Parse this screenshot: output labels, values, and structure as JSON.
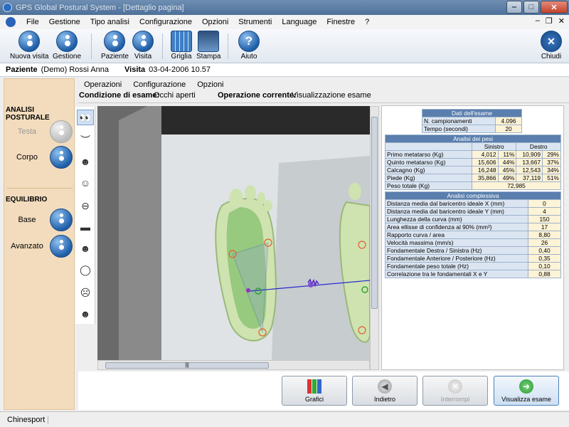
{
  "window": {
    "title": "GPS Global Postural System - [Dettaglio pagina]"
  },
  "menu": {
    "items": [
      "File",
      "Gestione",
      "Tipo analisi",
      "Configurazione",
      "Opzioni",
      "Strumenti",
      "Language",
      "Finestre",
      "?"
    ]
  },
  "toolbar": {
    "nuova_visita": "Nuova visita",
    "gestione": "Gestione",
    "paziente": "Paziente",
    "visita": "Visita",
    "griglia": "Griglia",
    "stampa": "Stampa",
    "aiuto": "Aiuto",
    "chiudi": "Chiudi"
  },
  "patient": {
    "label": "Paziente",
    "name": "(Demo) Rossi Anna",
    "visit_label": "Visita",
    "visit_date": "03-04-2006 10.57"
  },
  "left_panel": {
    "section1": "ANALISI POSTURALE",
    "testa": "Testa",
    "corpo": "Corpo",
    "section2": "EQUILIBRIO",
    "base": "Base",
    "avanzato": "Avanzato"
  },
  "subtabs": [
    "Operazioni",
    "Configurazione",
    "Opzioni"
  ],
  "condition": {
    "label": "Condizione di esame:",
    "value": "Occhi aperti",
    "op_label": "Operazione corrente:",
    "op_value": "Visualizzazione esame"
  },
  "exam_data": {
    "title": "Dati dell'esame",
    "rows": [
      {
        "label": "N. campionamenti",
        "value": "4.096"
      },
      {
        "label": "Tempo (secondi)",
        "value": "20"
      }
    ]
  },
  "weights": {
    "title": "Analisi dei pesi",
    "left": "Sinistro",
    "right": "Destro",
    "rows": [
      {
        "label": "Primo metatarso (Kg)",
        "l": "4,012",
        "lp": "11%",
        "r": "10,909",
        "rp": "29%"
      },
      {
        "label": "Quinto metatarso (Kg)",
        "l": "15,606",
        "lp": "44%",
        "r": "13,667",
        "rp": "37%"
      },
      {
        "label": "Calcagno (Kg)",
        "l": "16,248",
        "lp": "45%",
        "r": "12,543",
        "rp": "34%"
      },
      {
        "label": "Piede (Kg)",
        "l": "35,866",
        "lp": "49%",
        "r": "37,119",
        "rp": "51%"
      }
    ],
    "total_label": "Peso totale (Kg)",
    "total": "72,985"
  },
  "overall": {
    "title": "Analisi complessiva",
    "rows": [
      {
        "label": "Distanza media dal baricentro ideale X (mm)",
        "value": "0"
      },
      {
        "label": "Distanza media dal baricentro ideale Y (mm)",
        "value": "4"
      },
      {
        "label": "Lunghezza della curva (mm)",
        "value": "150"
      },
      {
        "label": "Area ellisse di confidenza al 90% (mm²)",
        "value": "17"
      },
      {
        "label": "Rapporto curva / area",
        "value": "8,80"
      },
      {
        "label": "Velocità massima (mm/s)",
        "value": "26"
      },
      {
        "label": "Fondamentale Destra / Sinistra (Hz)",
        "value": "0,40"
      },
      {
        "label": "Fondamentale Anteriore / Posteriore (Hz)",
        "value": "0,35"
      },
      {
        "label": "Fondamentale peso totale (Hz)",
        "value": "0,10"
      },
      {
        "label": "Correlazione tra le fondamentali X e Y",
        "value": "0,88"
      }
    ]
  },
  "bottom_buttons": {
    "grafici": "Grafici",
    "indietro": "Indietro",
    "interrompi": "Interrompi",
    "visualizza": "Visualizza esame"
  },
  "statusbar": {
    "text": "Chinesport"
  },
  "colors": {
    "accent": "#1f5ea8",
    "left_panel": "#f2dcbd",
    "table_header": "#5a7fae",
    "value_cell": "#fdf3d6"
  }
}
